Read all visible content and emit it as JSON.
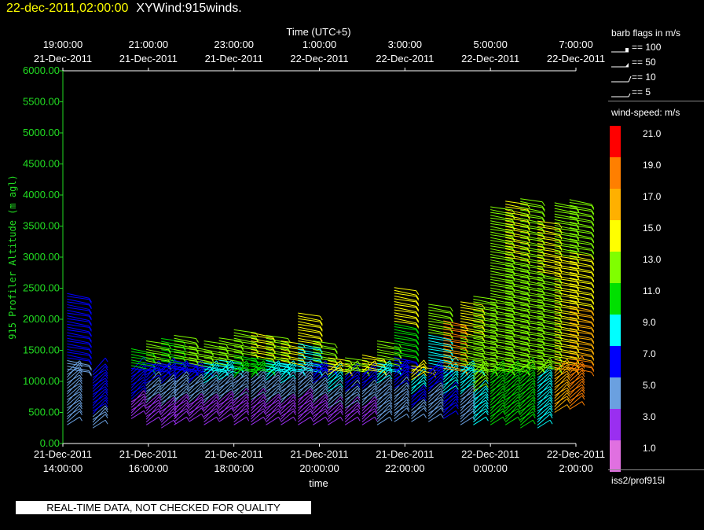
{
  "header": {
    "datetime": "22-dec-2011,02:00:00",
    "product": "XYWind:915winds."
  },
  "chart_data": {
    "type": "wind-barb-profile",
    "top_axis": {
      "label": "Time (UTC+5)",
      "ticks": [
        {
          "t": 14,
          "time": "19:00:00",
          "date": "21-Dec-2011"
        },
        {
          "t": 16,
          "time": "21:00:00",
          "date": "21-Dec-2011"
        },
        {
          "t": 18,
          "time": "23:00:00",
          "date": "21-Dec-2011"
        },
        {
          "t": 20,
          "time": "1:00:00",
          "date": "22-Dec-2011"
        },
        {
          "t": 22,
          "time": "3:00:00",
          "date": "22-Dec-2011"
        },
        {
          "t": 24,
          "time": "5:00:00",
          "date": "22-Dec-2011"
        },
        {
          "t": 26,
          "time": "7:00:00",
          "date": "22-Dec-2011"
        }
      ]
    },
    "bottom_axis": {
      "label": "time",
      "ticks": [
        {
          "t": 14,
          "date": "21-Dec-2011",
          "time": "14:00:00"
        },
        {
          "t": 16,
          "date": "21-Dec-2011",
          "time": "16:00:00"
        },
        {
          "t": 18,
          "date": "21-Dec-2011",
          "time": "18:00:00"
        },
        {
          "t": 20,
          "date": "21-Dec-2011",
          "time": "20:00:00"
        },
        {
          "t": 22,
          "date": "21-Dec-2011",
          "time": "22:00:00"
        },
        {
          "t": 24,
          "date": "22-Dec-2011",
          "time": "0:00:00"
        },
        {
          "t": 26,
          "date": "22-Dec-2011",
          "time": "2:00:00"
        }
      ]
    },
    "xlim": [
      14,
      26
    ],
    "y_axis": {
      "label": "915 Profiler Altitude (m agl)",
      "ylim": [
        0,
        6000
      ],
      "ticks": [
        "0.00",
        "500.00",
        "1000.00",
        "1500.00",
        "2000.00",
        "2500.00",
        "3000.00",
        "3500.00",
        "4000.00",
        "4500.00",
        "5000.00",
        "5500.00",
        "6000.00"
      ]
    },
    "profiles": [
      {
        "t": 14.1,
        "top": 2450,
        "base": 300,
        "speed": [
          4,
          5,
          7,
          6
        ]
      },
      {
        "t": 14.7,
        "top": 1150,
        "base": 250,
        "speed": [
          5,
          6,
          6,
          7
        ]
      },
      {
        "t": 15.6,
        "top": 1550,
        "base": 400,
        "speed": [
          3,
          6,
          7,
          11
        ]
      },
      {
        "t": 15.95,
        "top": 1650,
        "base": 300,
        "speed": [
          3,
          5,
          7,
          12
        ]
      },
      {
        "t": 16.3,
        "top": 1700,
        "base": 250,
        "speed": [
          3,
          4,
          7,
          11
        ]
      },
      {
        "t": 16.6,
        "top": 1750,
        "base": 300,
        "speed": [
          3,
          4,
          7,
          12
        ]
      },
      {
        "t": 16.95,
        "top": 1600,
        "base": 350,
        "speed": [
          3,
          4,
          7,
          12
        ]
      },
      {
        "t": 17.3,
        "top": 1650,
        "base": 300,
        "speed": [
          3,
          4,
          8,
          12
        ]
      },
      {
        "t": 17.65,
        "top": 1700,
        "base": 350,
        "speed": [
          3,
          5,
          8,
          13
        ]
      },
      {
        "t": 18.0,
        "top": 1850,
        "base": 300,
        "speed": [
          3,
          5,
          10,
          13
        ]
      },
      {
        "t": 18.4,
        "top": 1800,
        "base": 300,
        "speed": [
          3,
          5,
          11,
          14
        ]
      },
      {
        "t": 18.75,
        "top": 1750,
        "base": 300,
        "speed": [
          3,
          5,
          9,
          13
        ]
      },
      {
        "t": 19.1,
        "top": 1650,
        "base": 300,
        "speed": [
          3,
          4,
          9,
          14
        ]
      },
      {
        "t": 19.5,
        "top": 2100,
        "base": 300,
        "speed": [
          3,
          5,
          9,
          14
        ]
      },
      {
        "t": 19.85,
        "top": 1650,
        "base": 300,
        "speed": [
          3,
          5,
          7,
          13
        ]
      },
      {
        "t": 20.2,
        "top": 1400,
        "base": 300,
        "speed": [
          3,
          5,
          8,
          14
        ]
      },
      {
        "t": 20.6,
        "top": 1400,
        "base": 300,
        "speed": [
          3,
          5,
          7,
          13
        ]
      },
      {
        "t": 21.0,
        "top": 1450,
        "base": 300,
        "speed": [
          3,
          5,
          7,
          14
        ]
      },
      {
        "t": 21.35,
        "top": 1650,
        "base": 300,
        "speed": [
          4,
          5,
          9,
          13
        ]
      },
      {
        "t": 21.75,
        "top": 2550,
        "base": 350,
        "speed": [
          5,
          7,
          11,
          14
        ]
      },
      {
        "t": 22.15,
        "top": 1250,
        "base": 350,
        "speed": [
          4,
          6,
          9,
          14
        ]
      },
      {
        "t": 22.55,
        "top": 2250,
        "base": 350,
        "speed": [
          5,
          7,
          9,
          13
        ]
      },
      {
        "t": 22.9,
        "top": 2000,
        "base": 400,
        "speed": [
          6,
          8,
          16,
          18
        ]
      },
      {
        "t": 23.3,
        "top": 2300,
        "base": 300,
        "speed": [
          5,
          8,
          12,
          14
        ]
      },
      {
        "t": 23.6,
        "top": 2400,
        "base": 300,
        "speed": [
          9,
          12,
          12,
          13
        ]
      },
      {
        "t": 24.0,
        "top": 3850,
        "base": 300,
        "speed": [
          11,
          12,
          12,
          13
        ]
      },
      {
        "t": 24.35,
        "top": 3900,
        "base": 300,
        "speed": [
          11,
          12,
          12,
          14
        ]
      },
      {
        "t": 24.7,
        "top": 3950,
        "base": 250,
        "speed": [
          11,
          12,
          12,
          13
        ]
      },
      {
        "t": 25.1,
        "top": 3600,
        "base": 250,
        "speed": [
          8,
          12,
          13,
          14
        ]
      },
      {
        "t": 25.5,
        "top": 3900,
        "base": 500,
        "speed": [
          17,
          15,
          14,
          13
        ]
      },
      {
        "t": 25.85,
        "top": 3950,
        "base": 550,
        "speed": [
          18,
          16,
          14,
          13
        ]
      }
    ]
  },
  "legend": {
    "barb_title": "barb flags in m/s",
    "barbs": [
      {
        "label": "== 100",
        "kind": "flag"
      },
      {
        "label": "== 50",
        "kind": "pennant"
      },
      {
        "label": "== 10",
        "kind": "full"
      },
      {
        "label": "== 5",
        "kind": "half"
      }
    ],
    "speed_title": "wind-speed: m/s",
    "colorbar": [
      {
        "label": "21.0",
        "color": "#ff0000"
      },
      {
        "label": "19.0",
        "color": "#ff7f00"
      },
      {
        "label": "17.0",
        "color": "#ffb000"
      },
      {
        "label": "15.0",
        "color": "#ffff00"
      },
      {
        "label": "13.0",
        "color": "#80ff00"
      },
      {
        "label": "11.0",
        "color": "#00e000"
      },
      {
        "label": "9.0",
        "color": "#00ffff"
      },
      {
        "label": "7.0",
        "color": "#0000ff"
      },
      {
        "label": "5.0",
        "color": "#6aa0e0"
      },
      {
        "label": "3.0",
        "color": "#9a2ff0"
      },
      {
        "label": "1.0",
        "color": "#e070e0"
      }
    ],
    "station": "iss2/prof915l"
  },
  "footer": {
    "qc_notice": "REAL-TIME DATA, NOT CHECKED FOR QUALITY"
  }
}
